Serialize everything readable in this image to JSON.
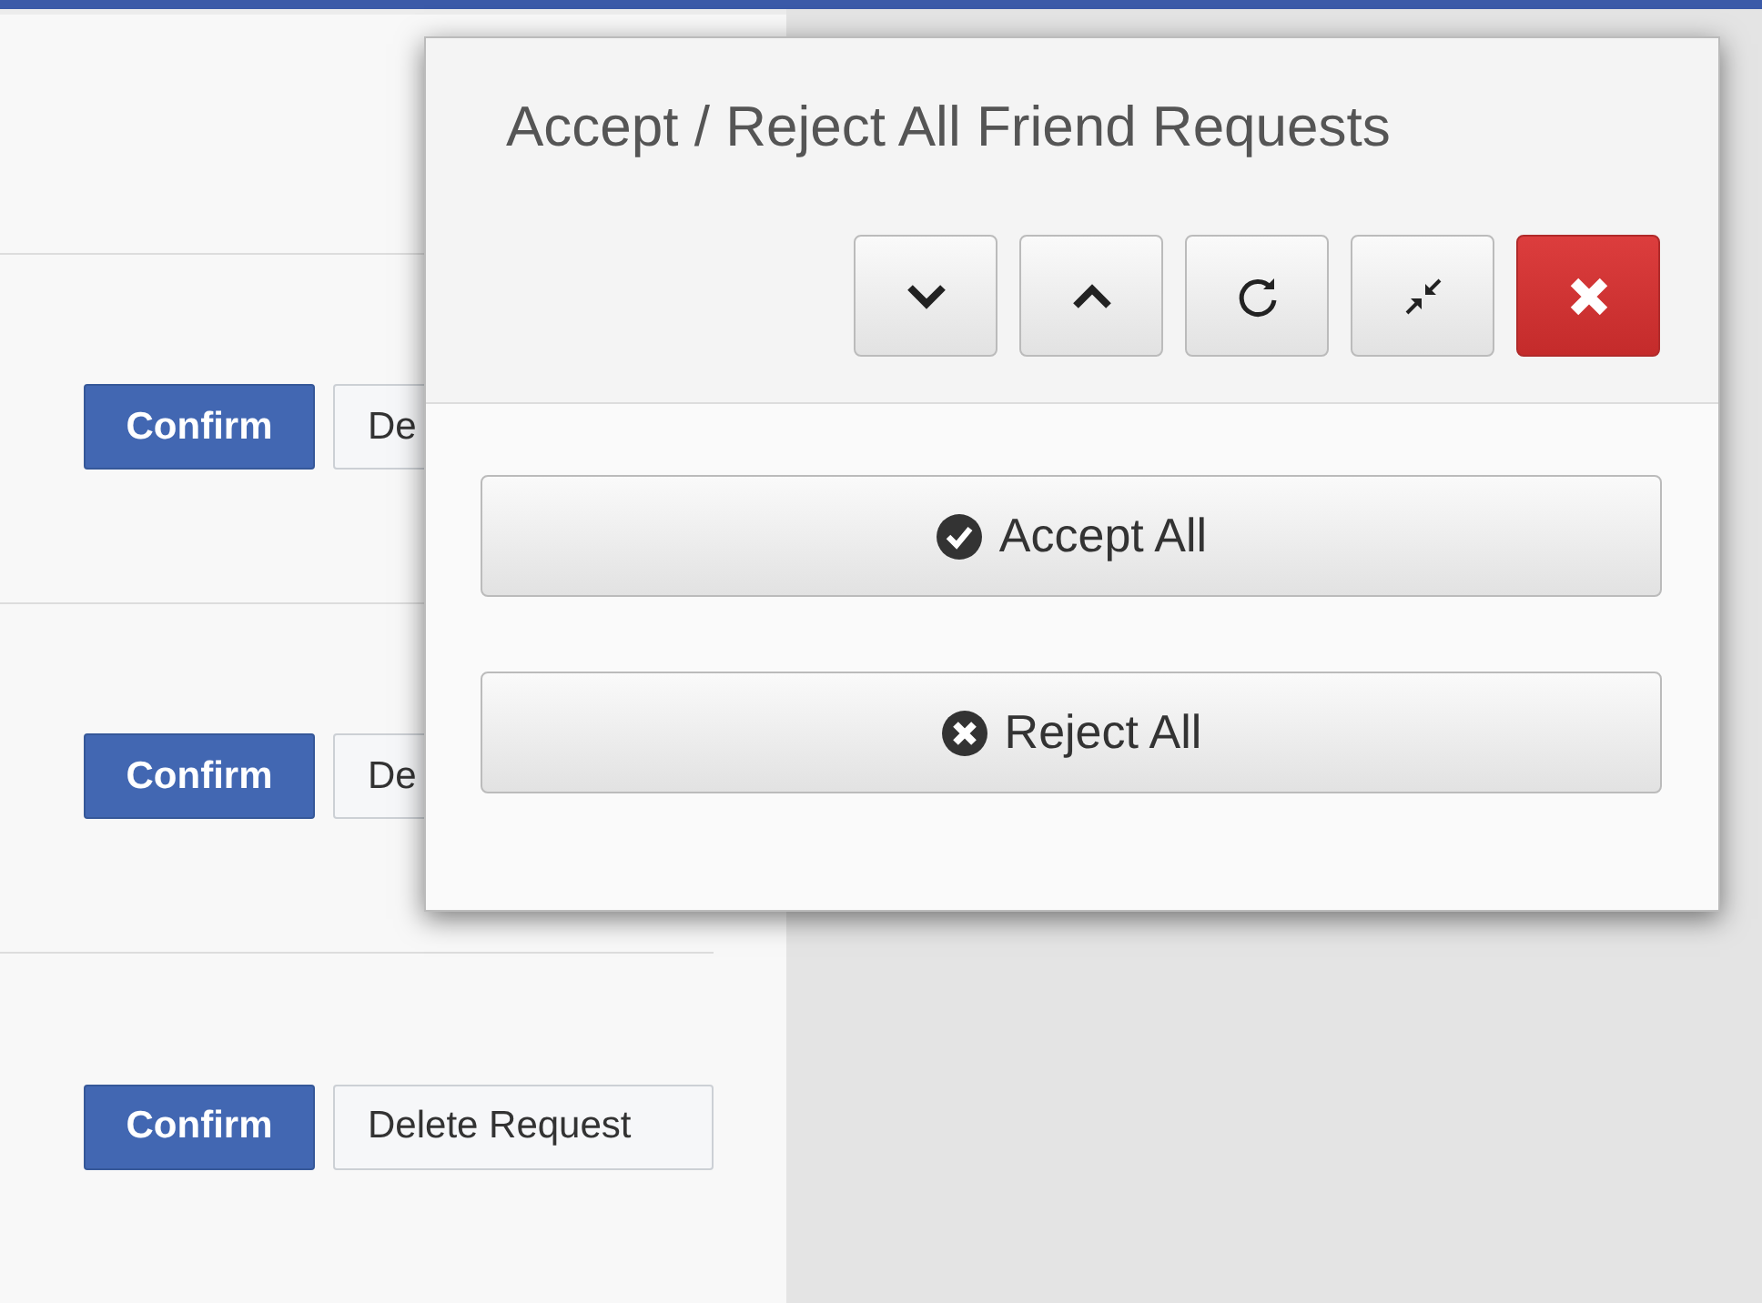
{
  "requests": [
    {
      "confirm": "Confirm",
      "delete": "De"
    },
    {
      "confirm": "Confirm",
      "delete": "De"
    },
    {
      "confirm": "Confirm",
      "delete": "Delete Request"
    }
  ],
  "dialog": {
    "title": "Accept / Reject All Friend Requests",
    "actions": [
      {
        "kind": "accept",
        "label": "Accept All"
      },
      {
        "kind": "reject",
        "label": "Reject All"
      }
    ]
  }
}
